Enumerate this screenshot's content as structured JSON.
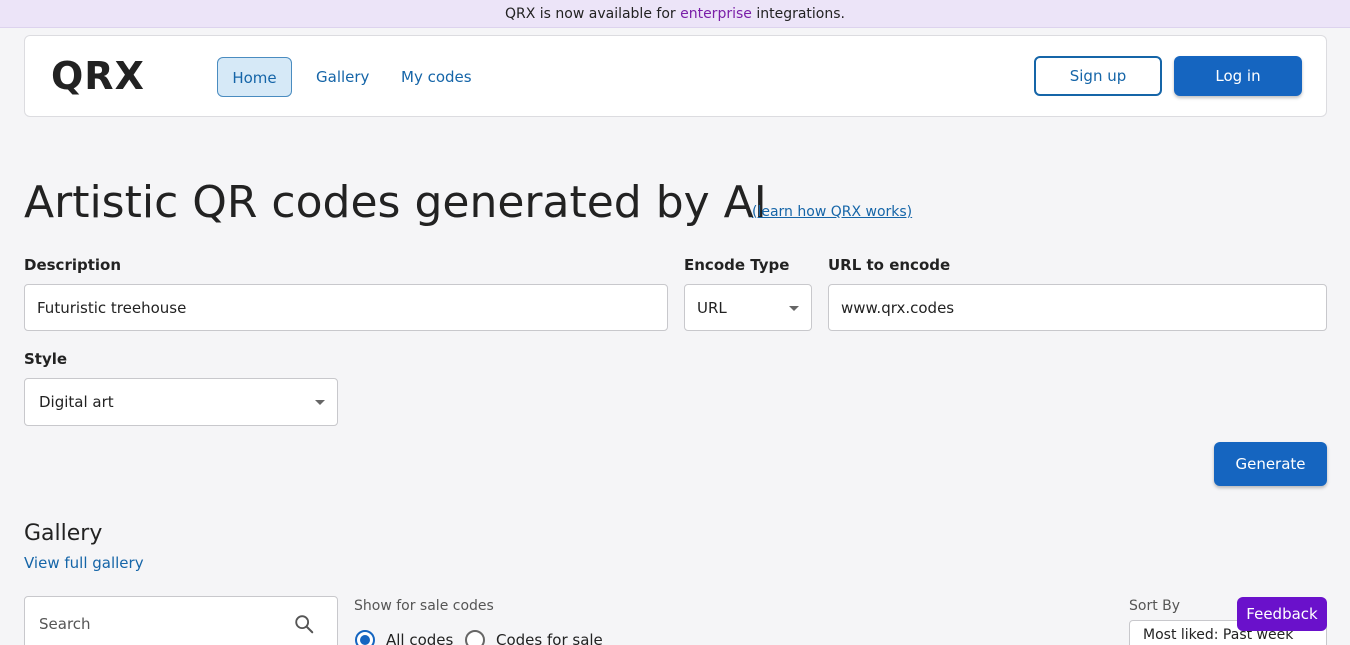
{
  "banner": {
    "prefix": "QRX is now available for ",
    "highlight": "enterprise",
    "suffix": " integrations."
  },
  "nav": {
    "logo": "QRX",
    "links": [
      "Home",
      "Gallery",
      "My codes"
    ],
    "signup": "Sign up",
    "login": "Log in"
  },
  "hero": {
    "title": "Artistic QR codes generated by AI",
    "learn_link": "(learn how QRX works)"
  },
  "form": {
    "description": {
      "label": "Description",
      "value": "Futuristic treehouse"
    },
    "encode_type": {
      "label": "Encode Type",
      "value": "URL"
    },
    "url": {
      "label": "URL to encode",
      "value": "www.qrx.codes"
    },
    "style": {
      "label": "Style",
      "value": "Digital art"
    },
    "generate": "Generate"
  },
  "gallery": {
    "title": "Gallery",
    "view_all": "View full gallery",
    "search_placeholder": "Search",
    "sale_label": "Show for sale codes",
    "radio_all": "All codes",
    "radio_sale": "Codes for sale",
    "sort_label": "Sort By",
    "sort_value": "Most liked: Past week"
  },
  "feedback": "Feedback",
  "colors": {
    "primary": "#1565c0",
    "feedback": "#6a11cb",
    "banner_bg": "#ece4f8"
  },
  "icons": [
    "search-icon",
    "dropdown-caret-icon"
  ]
}
